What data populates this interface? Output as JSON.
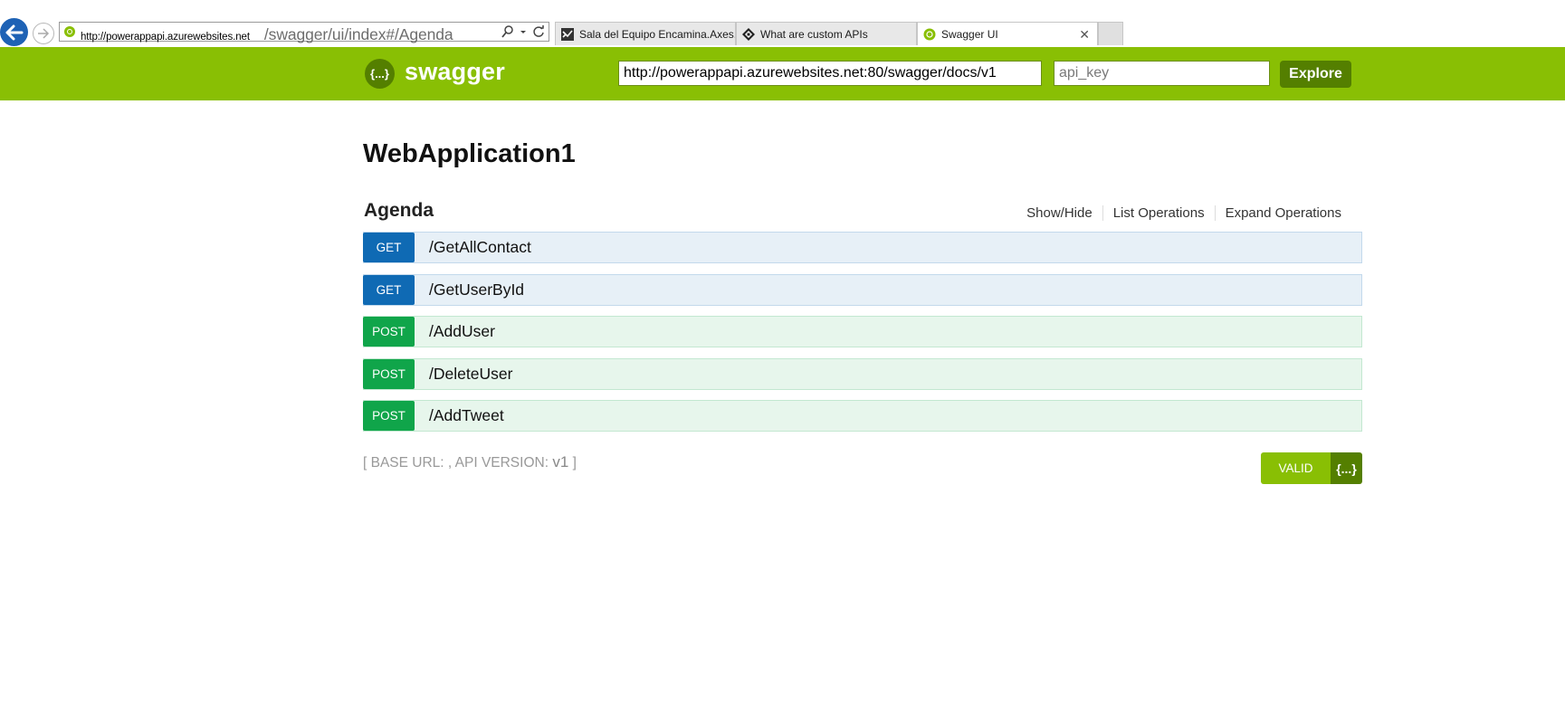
{
  "browser": {
    "address_url_host": "http://powerappapi.azurewebsites.net",
    "address_url_path": "/swagger/ui/index#/Agenda",
    "tabs": [
      {
        "label": "Sala del Equipo Encamina.Axes...",
        "icon": "visual-studio-icon"
      },
      {
        "label": "What are custom APIs",
        "icon": "diamond-logo-icon"
      },
      {
        "label": "Swagger UI",
        "icon": "swagger-favicon-icon"
      }
    ],
    "close_glyph": "✕"
  },
  "header": {
    "logo_text": "swagger",
    "logo_glyph": "{...}",
    "url_value": "http://powerappapi.azurewebsites.net:80/swagger/docs/v1",
    "api_key_placeholder": "api_key",
    "explore_label": "Explore"
  },
  "main": {
    "title": "WebApplication1",
    "resource": {
      "name": "Agenda",
      "links": [
        "Show/Hide",
        "List Operations",
        "Expand Operations"
      ],
      "operations": [
        {
          "verb": "GET",
          "path": "/GetAllContact"
        },
        {
          "verb": "GET",
          "path": "/GetUserById"
        },
        {
          "verb": "POST",
          "path": "/AddUser"
        },
        {
          "verb": "POST",
          "path": "/DeleteUser"
        },
        {
          "verb": "POST",
          "path": "/AddTweet"
        }
      ]
    },
    "footer": {
      "prefix": "[ BASE URL: , API VERSION: ",
      "version": "v1",
      "suffix": " ]"
    },
    "valid_badge": {
      "label": "VALID",
      "glyph": "{...}"
    }
  },
  "colors": {
    "swagger_green": "#89bf04",
    "swagger_dark_green": "#547f00",
    "get_blue": "#0f6ab4",
    "post_green": "#10a54a"
  }
}
